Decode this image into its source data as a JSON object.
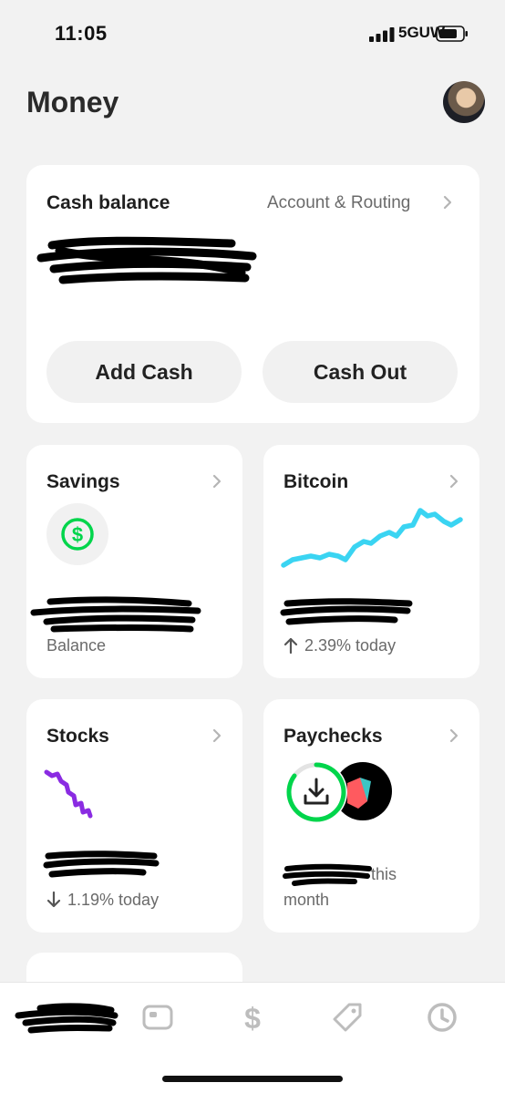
{
  "status": {
    "time": "11:05",
    "network": "5GUW"
  },
  "header": {
    "title": "Money"
  },
  "cash": {
    "title": "Cash balance",
    "account_link": "Account & Routing",
    "add_cash": "Add Cash",
    "cash_out": "Cash Out"
  },
  "savings": {
    "title": "Savings",
    "caption": "Balance"
  },
  "bitcoin": {
    "title": "Bitcoin",
    "change": "2.39% today",
    "line_color": "#3ad4f2"
  },
  "stocks": {
    "title": "Stocks",
    "change": "1.19% today",
    "line_color": "#8a2be2"
  },
  "paychecks": {
    "title": "Paychecks",
    "caption_part1": "this",
    "caption_part2": "month"
  },
  "colors": {
    "accent_green": "#00d54b"
  },
  "tabs": [
    "home-icon",
    "card-icon",
    "dollar-icon",
    "tag-icon",
    "clock-icon"
  ]
}
